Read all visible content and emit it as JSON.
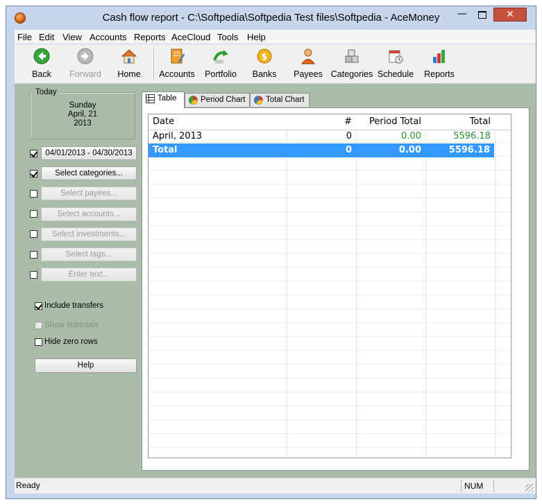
{
  "window": {
    "title": "Cash flow report - C:\\Softpedia\\Softpedia Test files\\Softpedia - AceMoney",
    "controls": {
      "minimize": "—",
      "close": "✕"
    }
  },
  "menu": [
    "File",
    "Edit",
    "View",
    "Accounts",
    "Reports",
    "AceCloud",
    "Tools",
    "Help"
  ],
  "toolbar": {
    "back": "Back",
    "forward": "Forward",
    "home": "Home",
    "accounts": "Accounts",
    "portfolio": "Portfolio",
    "banks": "Banks",
    "payees": "Payees",
    "categories": "Categories",
    "schedule": "Schedule",
    "reports": "Reports"
  },
  "today": {
    "legend": "Today",
    "weekday": "Sunday",
    "date": "April, 21",
    "year": "2013"
  },
  "filters": {
    "date_range": "04/01/2013 - 04/30/2013",
    "categories": "Select categories...",
    "payees": "Select payees...",
    "accounts": "Select accounts...",
    "investments": "Select investments...",
    "tags": "Select tags...",
    "text": "Enter text..."
  },
  "options": {
    "include_transfers": "Include transfers",
    "show_subtotals": "Show subtotals",
    "hide_zero_rows": "Hide zero rows"
  },
  "help": "Help",
  "tabs": {
    "table": "Table",
    "period_chart": "Period Chart",
    "total_chart": "Total Chart"
  },
  "table": {
    "headers": {
      "date": "Date",
      "count": "#",
      "period_total": "Period Total",
      "total": "Total"
    },
    "row": {
      "date": "April, 2013",
      "count": "0",
      "period_total": "0.00",
      "total": "5596.18"
    },
    "total_row": {
      "date": "Total",
      "count": "0",
      "period_total": "0.00",
      "total": "5596.18"
    }
  },
  "status": {
    "text": "Ready",
    "num": "NUM"
  },
  "colors": {
    "selection": "#3399ff",
    "positive": "#2d8a2d",
    "panel": "#a9bda9"
  }
}
